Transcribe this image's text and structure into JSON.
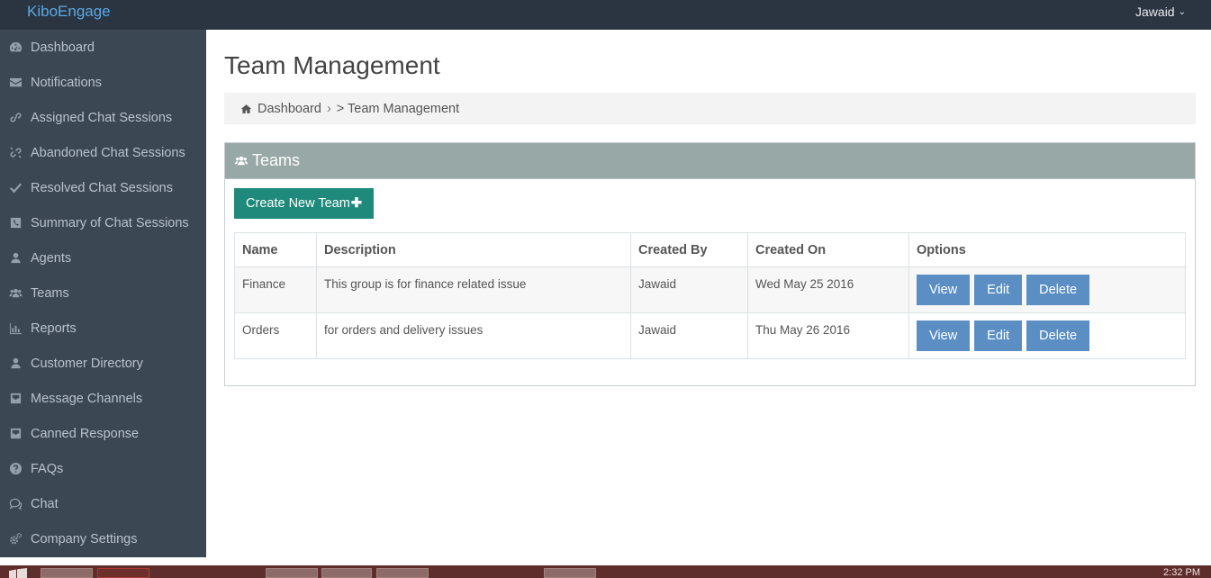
{
  "topbar": {
    "brand": "KiboEngage",
    "user": "Jawaid",
    "user_caret": "⌄"
  },
  "sidebar": {
    "items": [
      {
        "label": "Dashboard",
        "icon": "dashboard-icon"
      },
      {
        "label": "Notifications",
        "icon": "envelope-icon"
      },
      {
        "label": "Assigned Chat Sessions",
        "icon": "link-icon"
      },
      {
        "label": "Abandoned Chat Sessions",
        "icon": "unlink-icon"
      },
      {
        "label": "Resolved Chat Sessions",
        "icon": "check-icon"
      },
      {
        "label": "Summary of Chat Sessions",
        "icon": "phone-icon"
      },
      {
        "label": "Agents",
        "icon": "user-icon"
      },
      {
        "label": "Teams",
        "icon": "users-icon"
      },
      {
        "label": "Reports",
        "icon": "bar-chart-icon"
      },
      {
        "label": "Customer Directory",
        "icon": "user-icon"
      },
      {
        "label": "Message Channels",
        "icon": "inbox-icon"
      },
      {
        "label": "Canned Response",
        "icon": "inbox-icon"
      },
      {
        "label": "FAQs",
        "icon": "question-icon"
      },
      {
        "label": "Chat",
        "icon": "comments-icon"
      },
      {
        "label": "Company Settings",
        "icon": "cogs-icon"
      }
    ]
  },
  "main": {
    "title": "Team Management",
    "breadcrumb": {
      "home": "Dashboard",
      "sep": "›",
      "current": "> Team Management"
    },
    "panel": {
      "title": "Teams",
      "create_label": "Create New Team",
      "create_plus": "✚",
      "columns": [
        "Name",
        "Description",
        "Created By",
        "Created On",
        "Options"
      ],
      "rows": [
        {
          "name": "Finance",
          "description": "This group is for finance related issue",
          "created_by": "Jawaid",
          "created_on": "Wed May 25 2016"
        },
        {
          "name": "Orders",
          "description": "for orders and delivery issues",
          "created_by": "Jawaid",
          "created_on": "Thu May 26 2016"
        }
      ],
      "actions": {
        "view": "View",
        "edit": "Edit",
        "delete": "Delete"
      }
    }
  },
  "taskbar": {
    "clock": "2:32 PM"
  },
  "colors": {
    "topbar": "#2b3541",
    "sidebar": "#3c4754",
    "brand": "#5aa8e6",
    "panel_header": "#98a8a6",
    "create_button": "#1f8a7b",
    "action_button": "#5b8fc4"
  }
}
